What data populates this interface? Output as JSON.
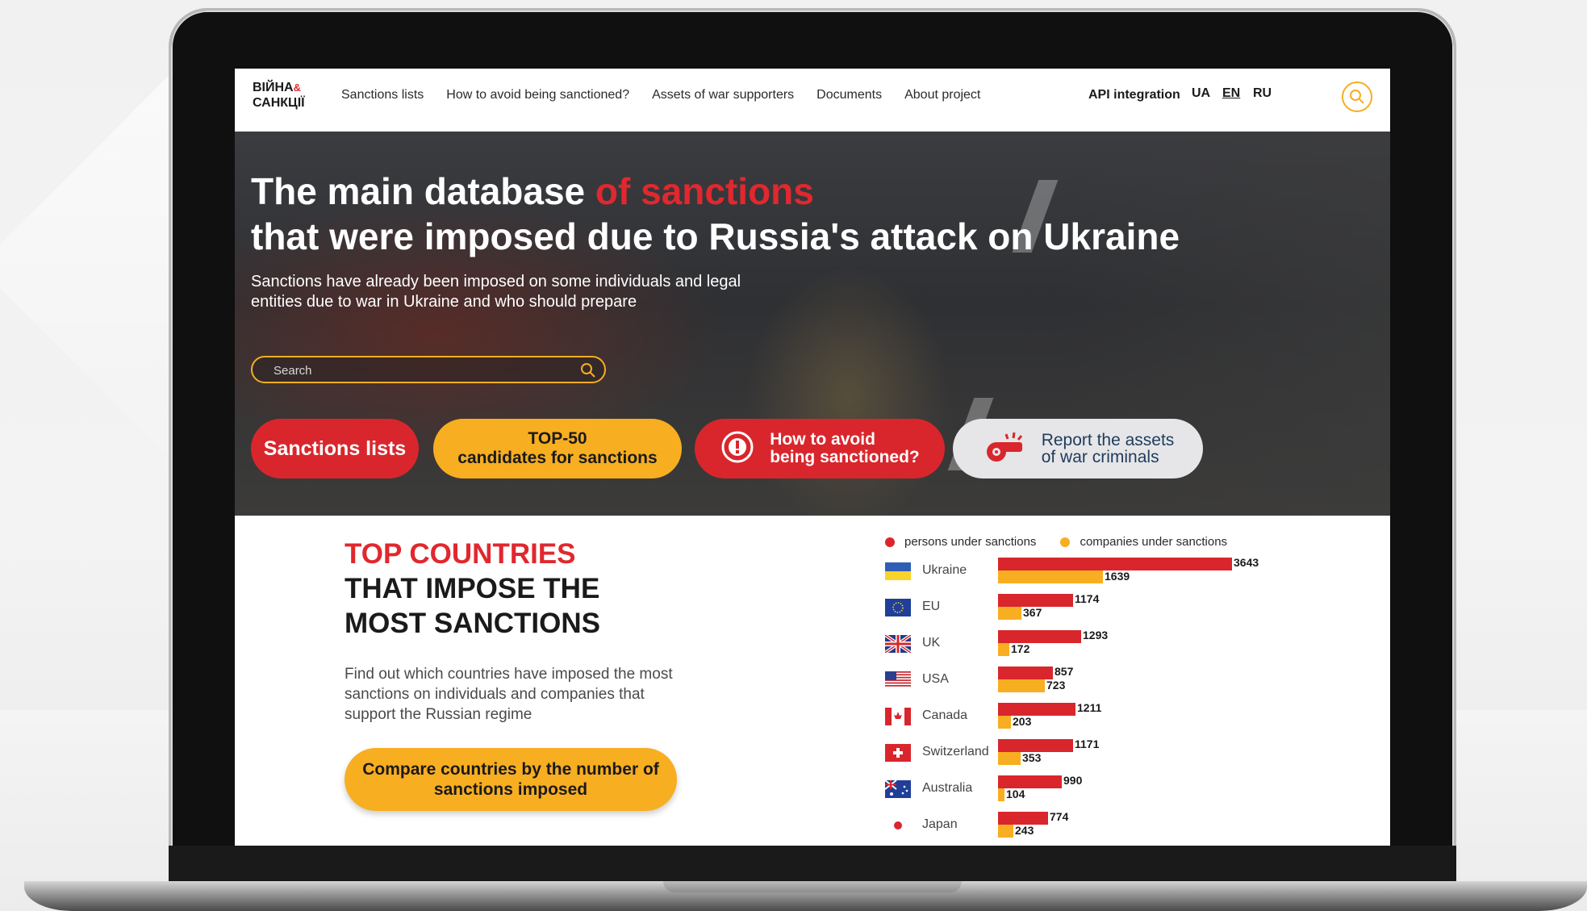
{
  "site": {
    "logo_line1": "ВІЙНА",
    "logo_amp": "&",
    "logo_line2": "САНКЦІЇ"
  },
  "nav": {
    "items": [
      {
        "label": "Sanctions lists"
      },
      {
        "label": "How to avoid being sanctioned?"
      },
      {
        "label": "Assets of war supporters"
      },
      {
        "label": "Documents"
      },
      {
        "label": "About project"
      }
    ],
    "api": "API integration",
    "langs": [
      "UA",
      "EN",
      "RU"
    ],
    "active_lang": "EN"
  },
  "hero": {
    "title_part1": "The main database ",
    "title_part2": "of sanctions",
    "title_line2": "that were imposed due to Russia's attack on Ukraine",
    "subtitle": "Sanctions have already been imposed on some individuals and legal entities due to war in Ukraine and who should prepare",
    "search_placeholder": "Search",
    "buttons": {
      "sanctions_lists": "Sanctions lists",
      "top50_line1": "TOP-50",
      "top50_line2": "candidates for sanctions",
      "avoid_line1": "How to avoid",
      "avoid_line2": "being sanctioned?",
      "report_line1": "Report the assets",
      "report_line2": "of war criminals"
    }
  },
  "top_countries": {
    "title_red": "TOP COUNTRIES",
    "title_line2": "THAT IMPOSE THE",
    "title_line3": "MOST SANCTIONS",
    "description": "Find out which countries have imposed the most sanctions on individuals and companies that support the Russian regime",
    "compare_button_line1": "Compare countries by the number of",
    "compare_button_line2": "sanctions imposed"
  },
  "colors": {
    "red": "#d9262c",
    "yellow": "#f8ae21"
  },
  "chart_data": {
    "type": "bar",
    "legend": [
      "persons under sanctions",
      "companies under sanctions"
    ],
    "legend_position": "top",
    "categories": [
      "Ukraine",
      "EU",
      "UK",
      "USA",
      "Canada",
      "Switzerland",
      "Australia",
      "Japan"
    ],
    "flags": [
      "flag-ukraine-icon",
      "flag-eu-icon",
      "flag-uk-icon",
      "flag-usa-icon",
      "flag-canada-icon",
      "flag-switzerland-icon",
      "flag-australia-icon",
      "flag-japan-icon"
    ],
    "series": [
      {
        "name": "persons under sanctions",
        "values": [
          "3643",
          "1174",
          "1293",
          "857",
          "1211",
          "1171",
          "990",
          "774"
        ]
      },
      {
        "name": "companies under sanctions",
        "values": [
          "1639",
          "367",
          "172",
          "723",
          "203",
          "353",
          "104",
          "243"
        ]
      }
    ],
    "labels_persons": [
      "3643",
      "1174",
      "1293",
      "857",
      "1211",
      "1171",
      "990",
      "774"
    ],
    "labels_persons_visible": [
      "3643",
      "1174",
      "1293",
      "857",
      "1211",
      "1171",
      "990",
      "774"
    ],
    "labels_shown_persons": [
      "3643",
      "1174",
      "1293",
      "857",
      "1211",
      "1171",
      "990",
      "774"
    ],
    "labels_shown_companies": [
      "1639",
      "367",
      "172",
      "723",
      "203",
      "353",
      "104",
      "243"
    ],
    "grid": false
  }
}
